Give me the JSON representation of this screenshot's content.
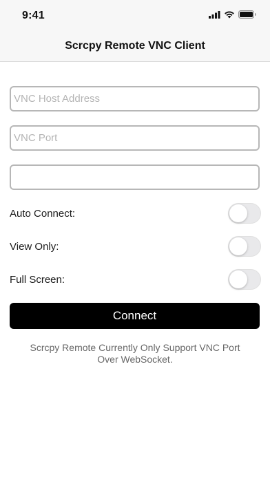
{
  "status_bar": {
    "time": "9:41",
    "icons": [
      "cellular-signal-icon",
      "wifi-icon",
      "battery-icon"
    ]
  },
  "header": {
    "title": "Scrcpy Remote VNC Client"
  },
  "form": {
    "host": {
      "placeholder": "VNC Host Address",
      "value": ""
    },
    "port": {
      "placeholder": "VNC Port",
      "value": ""
    },
    "password": {
      "placeholder": "",
      "value": ""
    }
  },
  "options": [
    {
      "label": "Auto Connect:",
      "on": false
    },
    {
      "label": "View Only:",
      "on": false
    },
    {
      "label": "Full Screen:",
      "on": false
    }
  ],
  "connect_button": {
    "label": "Connect",
    "color": "#000000"
  },
  "notice": {
    "line1": "Scrcpy Remote Currently Only Support VNC Port",
    "line2": "Over WebSocket."
  }
}
